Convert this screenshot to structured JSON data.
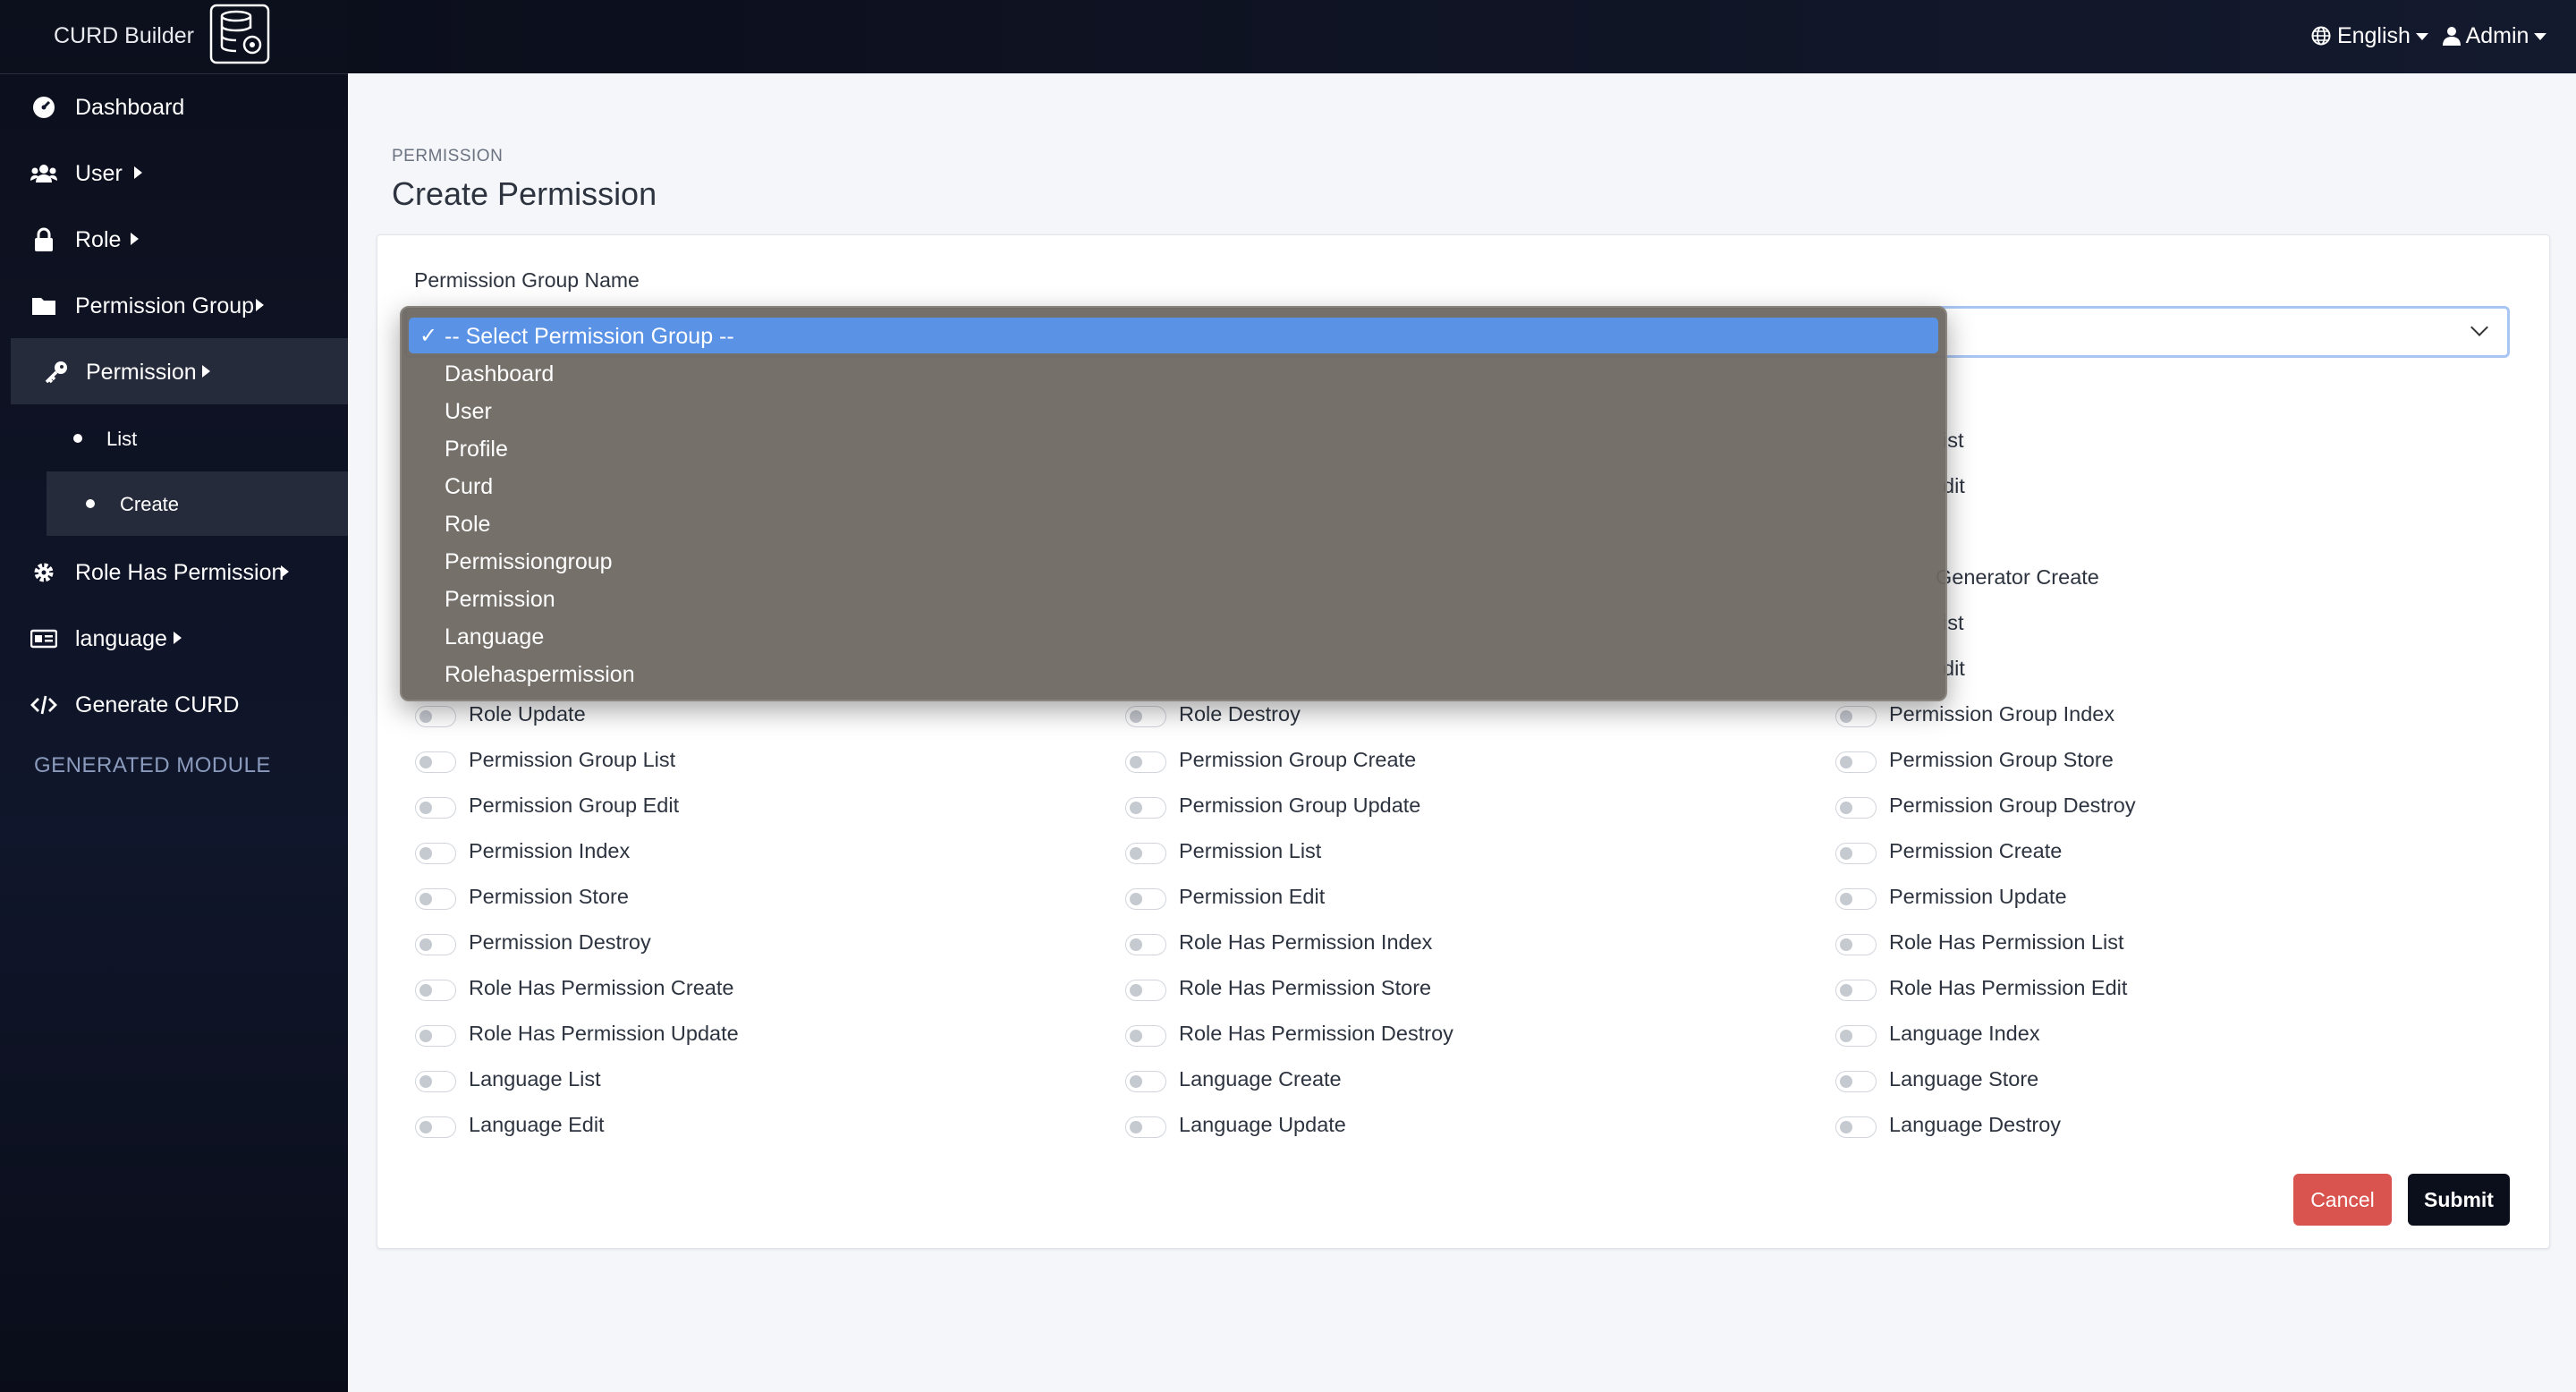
{
  "brand": {
    "title": "CURD Builder"
  },
  "sidebar": {
    "items": [
      {
        "label": "Dashboard"
      },
      {
        "label": "User"
      },
      {
        "label": "Role"
      },
      {
        "label": "Permission Group"
      },
      {
        "label": "Permission"
      },
      {
        "label": "Role Has Permission"
      },
      {
        "label": "language"
      },
      {
        "label": "Generate CURD"
      }
    ],
    "permission_sub": [
      {
        "label": "List"
      },
      {
        "label": "Create"
      }
    ],
    "section_title": "GENERATED MODULE"
  },
  "topbar": {
    "language": "English",
    "user": "Admin"
  },
  "page": {
    "breadcrumb": "PERMISSION",
    "title": "Create Permission"
  },
  "form": {
    "group_label": "Permission Group Name",
    "submit_label": "Submit",
    "cancel_label": "Cancel"
  },
  "dropdown": {
    "selected": "-- Select Permission Group --",
    "options": [
      "Dashboard",
      "User",
      "Profile",
      "Curd",
      "Role",
      "Permissiongroup",
      "Permission",
      "Language",
      "Rolehaspermission"
    ]
  },
  "permissions_partial": [
    "ist",
    "dit",
    "Generator Create",
    "ist",
    "dit"
  ],
  "permissions": {
    "col1": [
      "Role Update",
      "Permission Group List",
      "Permission Group Edit",
      "Permission Index",
      "Permission Store",
      "Permission Destroy",
      "Role Has Permission Create",
      "Role Has Permission Update",
      "Language List",
      "Language Edit"
    ],
    "col2": [
      "Role Destroy",
      "Permission Group Create",
      "Permission Group Update",
      "Permission List",
      "Permission Edit",
      "Role Has Permission Index",
      "Role Has Permission Store",
      "Role Has Permission Destroy",
      "Language Create",
      "Language Update"
    ],
    "col3": [
      "Permission Group Index",
      "Permission Group Store",
      "Permission Group Destroy",
      "Permission Create",
      "Permission Update",
      "Role Has Permission List",
      "Role Has Permission Edit",
      "Language Index",
      "Language Store",
      "Language Destroy"
    ]
  },
  "colors": {
    "sidebar_bg": "#0c0f1c",
    "cancel": "#d9534f",
    "submit": "#0b0e1b",
    "dropdown_selected": "#5a92e6"
  }
}
